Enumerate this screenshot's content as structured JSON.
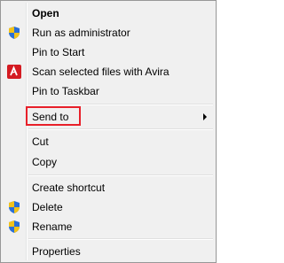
{
  "menu": {
    "items": [
      {
        "label": "Open",
        "icon": "none"
      },
      {
        "label": "Run as administrator",
        "icon": "uac-shield-icon"
      },
      {
        "label": "Pin to Start",
        "icon": "none"
      },
      {
        "label": "Scan selected files with Avira",
        "icon": "avira-icon"
      },
      {
        "label": "Pin to Taskbar",
        "icon": "none"
      },
      {
        "label": "Send to",
        "icon": "none",
        "has_submenu": true
      },
      {
        "label": "Cut",
        "icon": "none"
      },
      {
        "label": "Copy",
        "icon": "none"
      },
      {
        "label": "Create shortcut",
        "icon": "none"
      },
      {
        "label": "Delete",
        "icon": "uac-shield-icon"
      },
      {
        "label": "Rename",
        "icon": "uac-shield-icon"
      },
      {
        "label": "Properties",
        "icon": "none"
      }
    ],
    "highlighted_item": "Send to"
  },
  "colors": {
    "menu_bg": "#f0f0f0",
    "border": "#979797",
    "highlight_box": "#e8202a",
    "avira_red": "#d41b22",
    "shield_blue": "#2a6fd6",
    "shield_yellow": "#f2c21a"
  }
}
